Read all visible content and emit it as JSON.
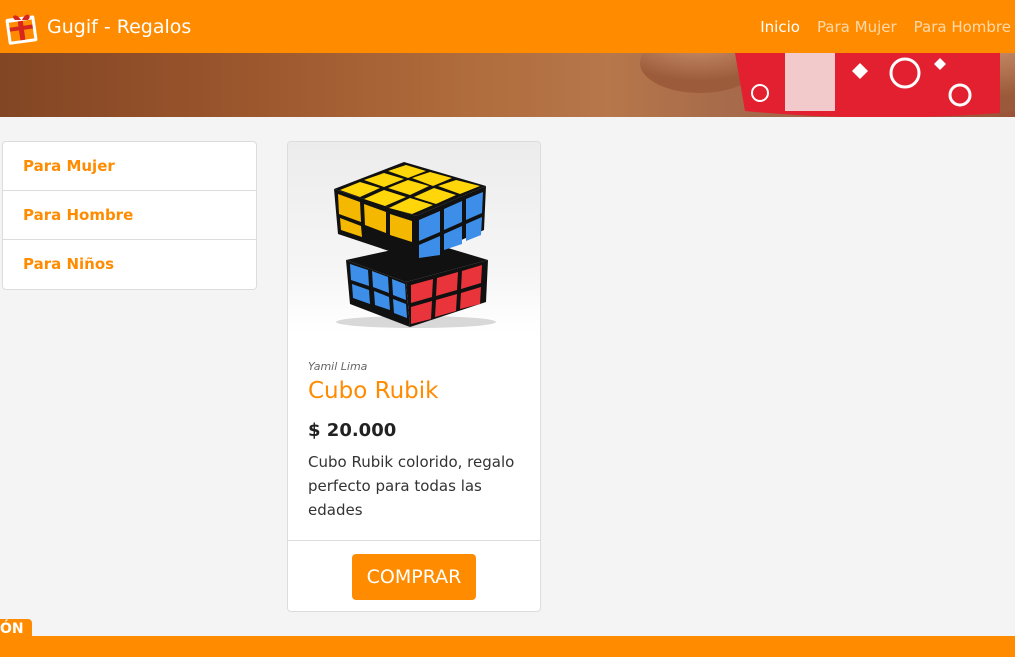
{
  "app": {
    "title": "Gugif - Regalos",
    "logo_icon": "gift-icon"
  },
  "nav": {
    "items": [
      {
        "label": "Inicio",
        "active": true
      },
      {
        "label": "Para Mujer",
        "active": false
      },
      {
        "label": "Para Hombre",
        "active": false
      }
    ]
  },
  "sidebar": {
    "items": [
      {
        "label": "Para Mujer"
      },
      {
        "label": "Para Hombre"
      },
      {
        "label": "Para Niños"
      }
    ]
  },
  "product": {
    "author": "Yamil Lima",
    "name": "Cubo Rubik",
    "price": "$ 20.000",
    "description": "Cubo Rubik colorido, regalo perfecto para todas las edades",
    "button_label": "COMPRAR",
    "image_icon": "rubik-cube-image"
  },
  "footer": {
    "tab_label": "ÓN"
  },
  "colors": {
    "accent": "#ff8c00",
    "background": "#f4f4f4"
  }
}
